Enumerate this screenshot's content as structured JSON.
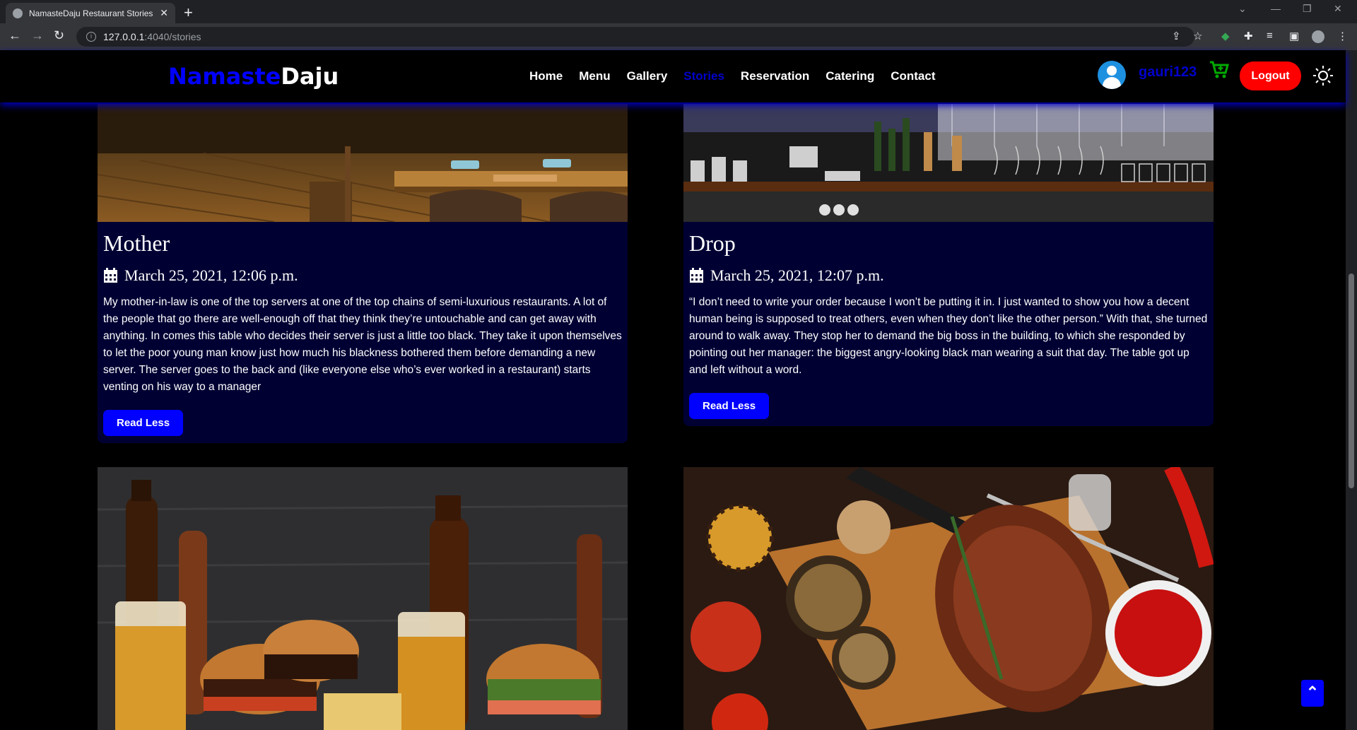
{
  "browser": {
    "tab_title": "NamasteDaju Restaurant Stories",
    "url_host": "127.0.0.1",
    "url_path": ":4040/stories"
  },
  "site": {
    "logo_part1": "Namaste",
    "logo_part2": "Daju",
    "nav": [
      "Home",
      "Menu",
      "Gallery",
      "Stories",
      "Reservation",
      "Catering",
      "Contact"
    ],
    "active_nav": "Stories",
    "username": "gauri123",
    "logout_label": "Logout"
  },
  "stories": [
    {
      "title": "Mother",
      "date": "March 25, 2021, 12:06 p.m.",
      "text": "My mother-in-law is one of the top servers at one of the top chains of semi-luxurious restaurants. A lot of the people that go there are well-enough off that they think they’re untouchable and can get away with anything. In comes this table who decides their server is just a little too black. They take it upon themselves to let the poor young man know just how much his blackness bothered them before demanding a new server. The server goes to the back and (like everyone else who’s ever worked in a restaurant) starts venting on his way to a manager",
      "button": "Read Less"
    },
    {
      "title": "Drop",
      "date": "March 25, 2021, 12:07 p.m.",
      "text": "“I don’t need to write your order because I won’t be putting it in. I just wanted to show you how a decent human being is supposed to treat others, even when they don’t like the other person.” With that, she turned around to walk away. They stop her to demand the big boss in the building, to which she responded by pointing out her manager: the biggest angry-looking black man wearing a suit that day. The table got up and left without a word.",
      "button": "Read Less"
    }
  ],
  "colors": {
    "brand_blue": "#0000ff",
    "card_bg": "#000033",
    "logout_red": "#ff0000"
  }
}
